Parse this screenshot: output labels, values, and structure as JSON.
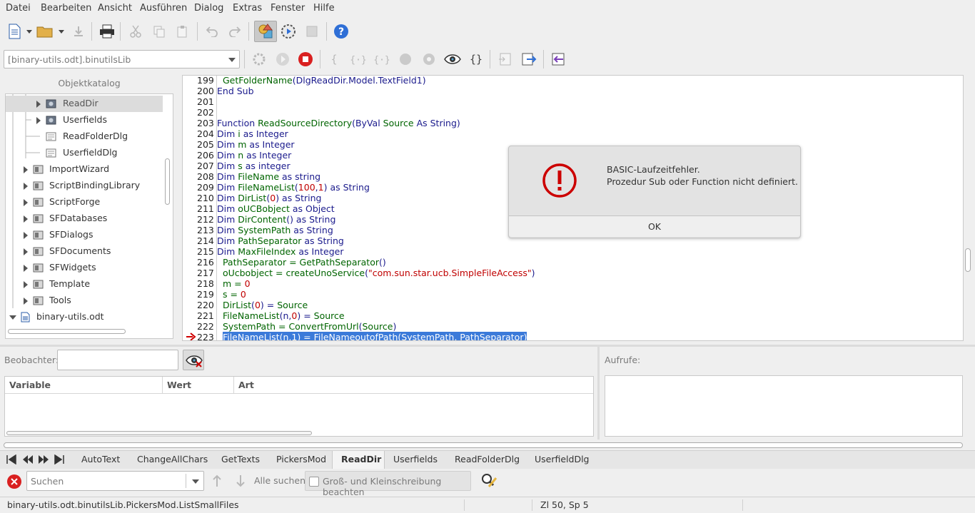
{
  "menu": [
    "Datei",
    "Bearbeiten",
    "Ansicht",
    "Ausführen",
    "Dialog",
    "Extras",
    "Fenster",
    "Hilfe"
  ],
  "library_combo": "[binary-utils.odt].binutilsLib",
  "object_catalog": {
    "title": "Objektkatalog",
    "items": [
      {
        "label": "ReadDir",
        "type": "module",
        "selected": true
      },
      {
        "label": "Userfields",
        "type": "module"
      },
      {
        "label": "ReadFolderDlg",
        "type": "dialog"
      },
      {
        "label": "UserfieldDlg",
        "type": "dialog"
      },
      {
        "label": "ImportWizard",
        "type": "library"
      },
      {
        "label": "ScriptBindingLibrary",
        "type": "library"
      },
      {
        "label": "ScriptForge",
        "type": "library"
      },
      {
        "label": "SFDatabases",
        "type": "library"
      },
      {
        "label": "SFDialogs",
        "type": "library"
      },
      {
        "label": "SFDocuments",
        "type": "library"
      },
      {
        "label": "SFWidgets",
        "type": "library"
      },
      {
        "label": "Template",
        "type": "library"
      },
      {
        "label": "Tools",
        "type": "library"
      },
      {
        "label": "binary-utils.odt",
        "type": "document"
      }
    ]
  },
  "editor": {
    "line_numbers": [
      "199",
      "200",
      "201",
      "202",
      "203",
      "204",
      "205",
      "206",
      "207",
      "208",
      "209",
      "210",
      "211",
      "212",
      "213",
      "214",
      "215",
      "216",
      "217",
      "218",
      "219",
      "220",
      "221",
      "222",
      "223"
    ],
    "lines": [
      [
        {
          "t": "  "
        },
        {
          "t": "GetFolderName",
          "c": "id"
        },
        {
          "t": "(DlgReadDir.Model.TextField1)"
        }
      ],
      [
        {
          "t": "End Sub"
        }
      ],
      [],
      [],
      [
        {
          "t": "Function "
        },
        {
          "t": "ReadSourceDirectory",
          "c": "id"
        },
        {
          "t": "(ByVal "
        },
        {
          "t": "Source",
          "c": "id"
        },
        {
          "t": " As String)"
        }
      ],
      [
        {
          "t": "Dim "
        },
        {
          "t": "i",
          "c": "id"
        },
        {
          "t": " as Integer"
        }
      ],
      [
        {
          "t": "Dim "
        },
        {
          "t": "m",
          "c": "id"
        },
        {
          "t": " as Integer"
        }
      ],
      [
        {
          "t": "Dim "
        },
        {
          "t": "n",
          "c": "id"
        },
        {
          "t": " as Integer"
        }
      ],
      [
        {
          "t": "Dim "
        },
        {
          "t": "s",
          "c": "id"
        },
        {
          "t": " as integer"
        }
      ],
      [
        {
          "t": "Dim "
        },
        {
          "t": "FileName",
          "c": "id"
        },
        {
          "t": " as string"
        }
      ],
      [
        {
          "t": "Dim "
        },
        {
          "t": "FileNameList",
          "c": "id"
        },
        {
          "t": "("
        },
        {
          "t": "100",
          "c": "num"
        },
        {
          "t": ","
        },
        {
          "t": "1",
          "c": "num"
        },
        {
          "t": ") as String"
        }
      ],
      [
        {
          "t": "Dim "
        },
        {
          "t": "DirList",
          "c": "id"
        },
        {
          "t": "("
        },
        {
          "t": "0",
          "c": "num"
        },
        {
          "t": ") as String"
        }
      ],
      [
        {
          "t": "Dim "
        },
        {
          "t": "oUCBobject",
          "c": "id"
        },
        {
          "t": " as Object"
        }
      ],
      [
        {
          "t": "Dim "
        },
        {
          "t": "DirContent",
          "c": "id"
        },
        {
          "t": "() as String"
        }
      ],
      [
        {
          "t": "Dim "
        },
        {
          "t": "SystemPath",
          "c": "id"
        },
        {
          "t": " as String"
        }
      ],
      [
        {
          "t": "Dim "
        },
        {
          "t": "PathSeparator",
          "c": "id"
        },
        {
          "t": " as String"
        }
      ],
      [
        {
          "t": "Dim "
        },
        {
          "t": "MaxFileIndex",
          "c": "id"
        },
        {
          "t": " as Integer"
        }
      ],
      [
        {
          "t": "  "
        },
        {
          "t": "PathSeparator = GetPathSeparator",
          "c": "id"
        },
        {
          "t": "()"
        }
      ],
      [
        {
          "t": "  "
        },
        {
          "t": "oUcbobject = createUnoService",
          "c": "id"
        },
        {
          "t": "("
        },
        {
          "t": "\"com.sun.star.ucb.SimpleFileAccess\"",
          "c": "str"
        },
        {
          "t": ")"
        }
      ],
      [
        {
          "t": "  "
        },
        {
          "t": "m = ",
          "c": "id"
        },
        {
          "t": "0",
          "c": "num"
        }
      ],
      [
        {
          "t": "  "
        },
        {
          "t": "s = ",
          "c": "id"
        },
        {
          "t": "0",
          "c": "num"
        }
      ],
      [
        {
          "t": "  "
        },
        {
          "t": "DirList",
          "c": "id"
        },
        {
          "t": "("
        },
        {
          "t": "0",
          "c": "num"
        },
        {
          "t": ") = "
        },
        {
          "t": "Source",
          "c": "id"
        }
      ],
      [
        {
          "t": "  "
        },
        {
          "t": "FileNameList",
          "c": "id"
        },
        {
          "t": "(n,"
        },
        {
          "t": "0",
          "c": "num"
        },
        {
          "t": ") = "
        },
        {
          "t": "Source",
          "c": "id"
        }
      ],
      [
        {
          "t": "  "
        },
        {
          "t": "SystemPath = ConvertFromUrl",
          "c": "id"
        },
        {
          "t": "("
        },
        {
          "t": "Source",
          "c": "id"
        },
        {
          "t": ")"
        }
      ],
      [
        {
          "t": "  "
        },
        {
          "t": "FileNameList(n,1) = FileNameoutofPath(SystemPath, PathSeparator)",
          "c": "hl"
        }
      ]
    ]
  },
  "dialog": {
    "title": "BASIC-Laufzeitfehler.",
    "message": "Prozedur Sub oder Function nicht definiert.",
    "ok_label": "OK"
  },
  "watch": {
    "label": "Beobachter:",
    "columns": [
      "Variable",
      "Wert",
      "Art"
    ]
  },
  "calls": {
    "label": "Aufrufe:"
  },
  "tabs": [
    "AutoText",
    "ChangeAllChars",
    "GetTexts",
    "PickersMod",
    "ReadDir",
    "Userfields",
    "ReadFolderDlg",
    "UserfieldDlg"
  ],
  "active_tab": "ReadDir",
  "find": {
    "placeholder": "Suchen",
    "find_all": "Alle suchen",
    "match_case": "Groß- und Kleinschreibung beachten"
  },
  "status": {
    "path": "binary-utils.odt.binutilsLib.PickersMod.ListSmallFiles",
    "position": "Zl 50, Sp 5"
  },
  "colors": {
    "accent": "#3b7ad9",
    "error": "#cc0000",
    "help": "#2f6fd6"
  }
}
